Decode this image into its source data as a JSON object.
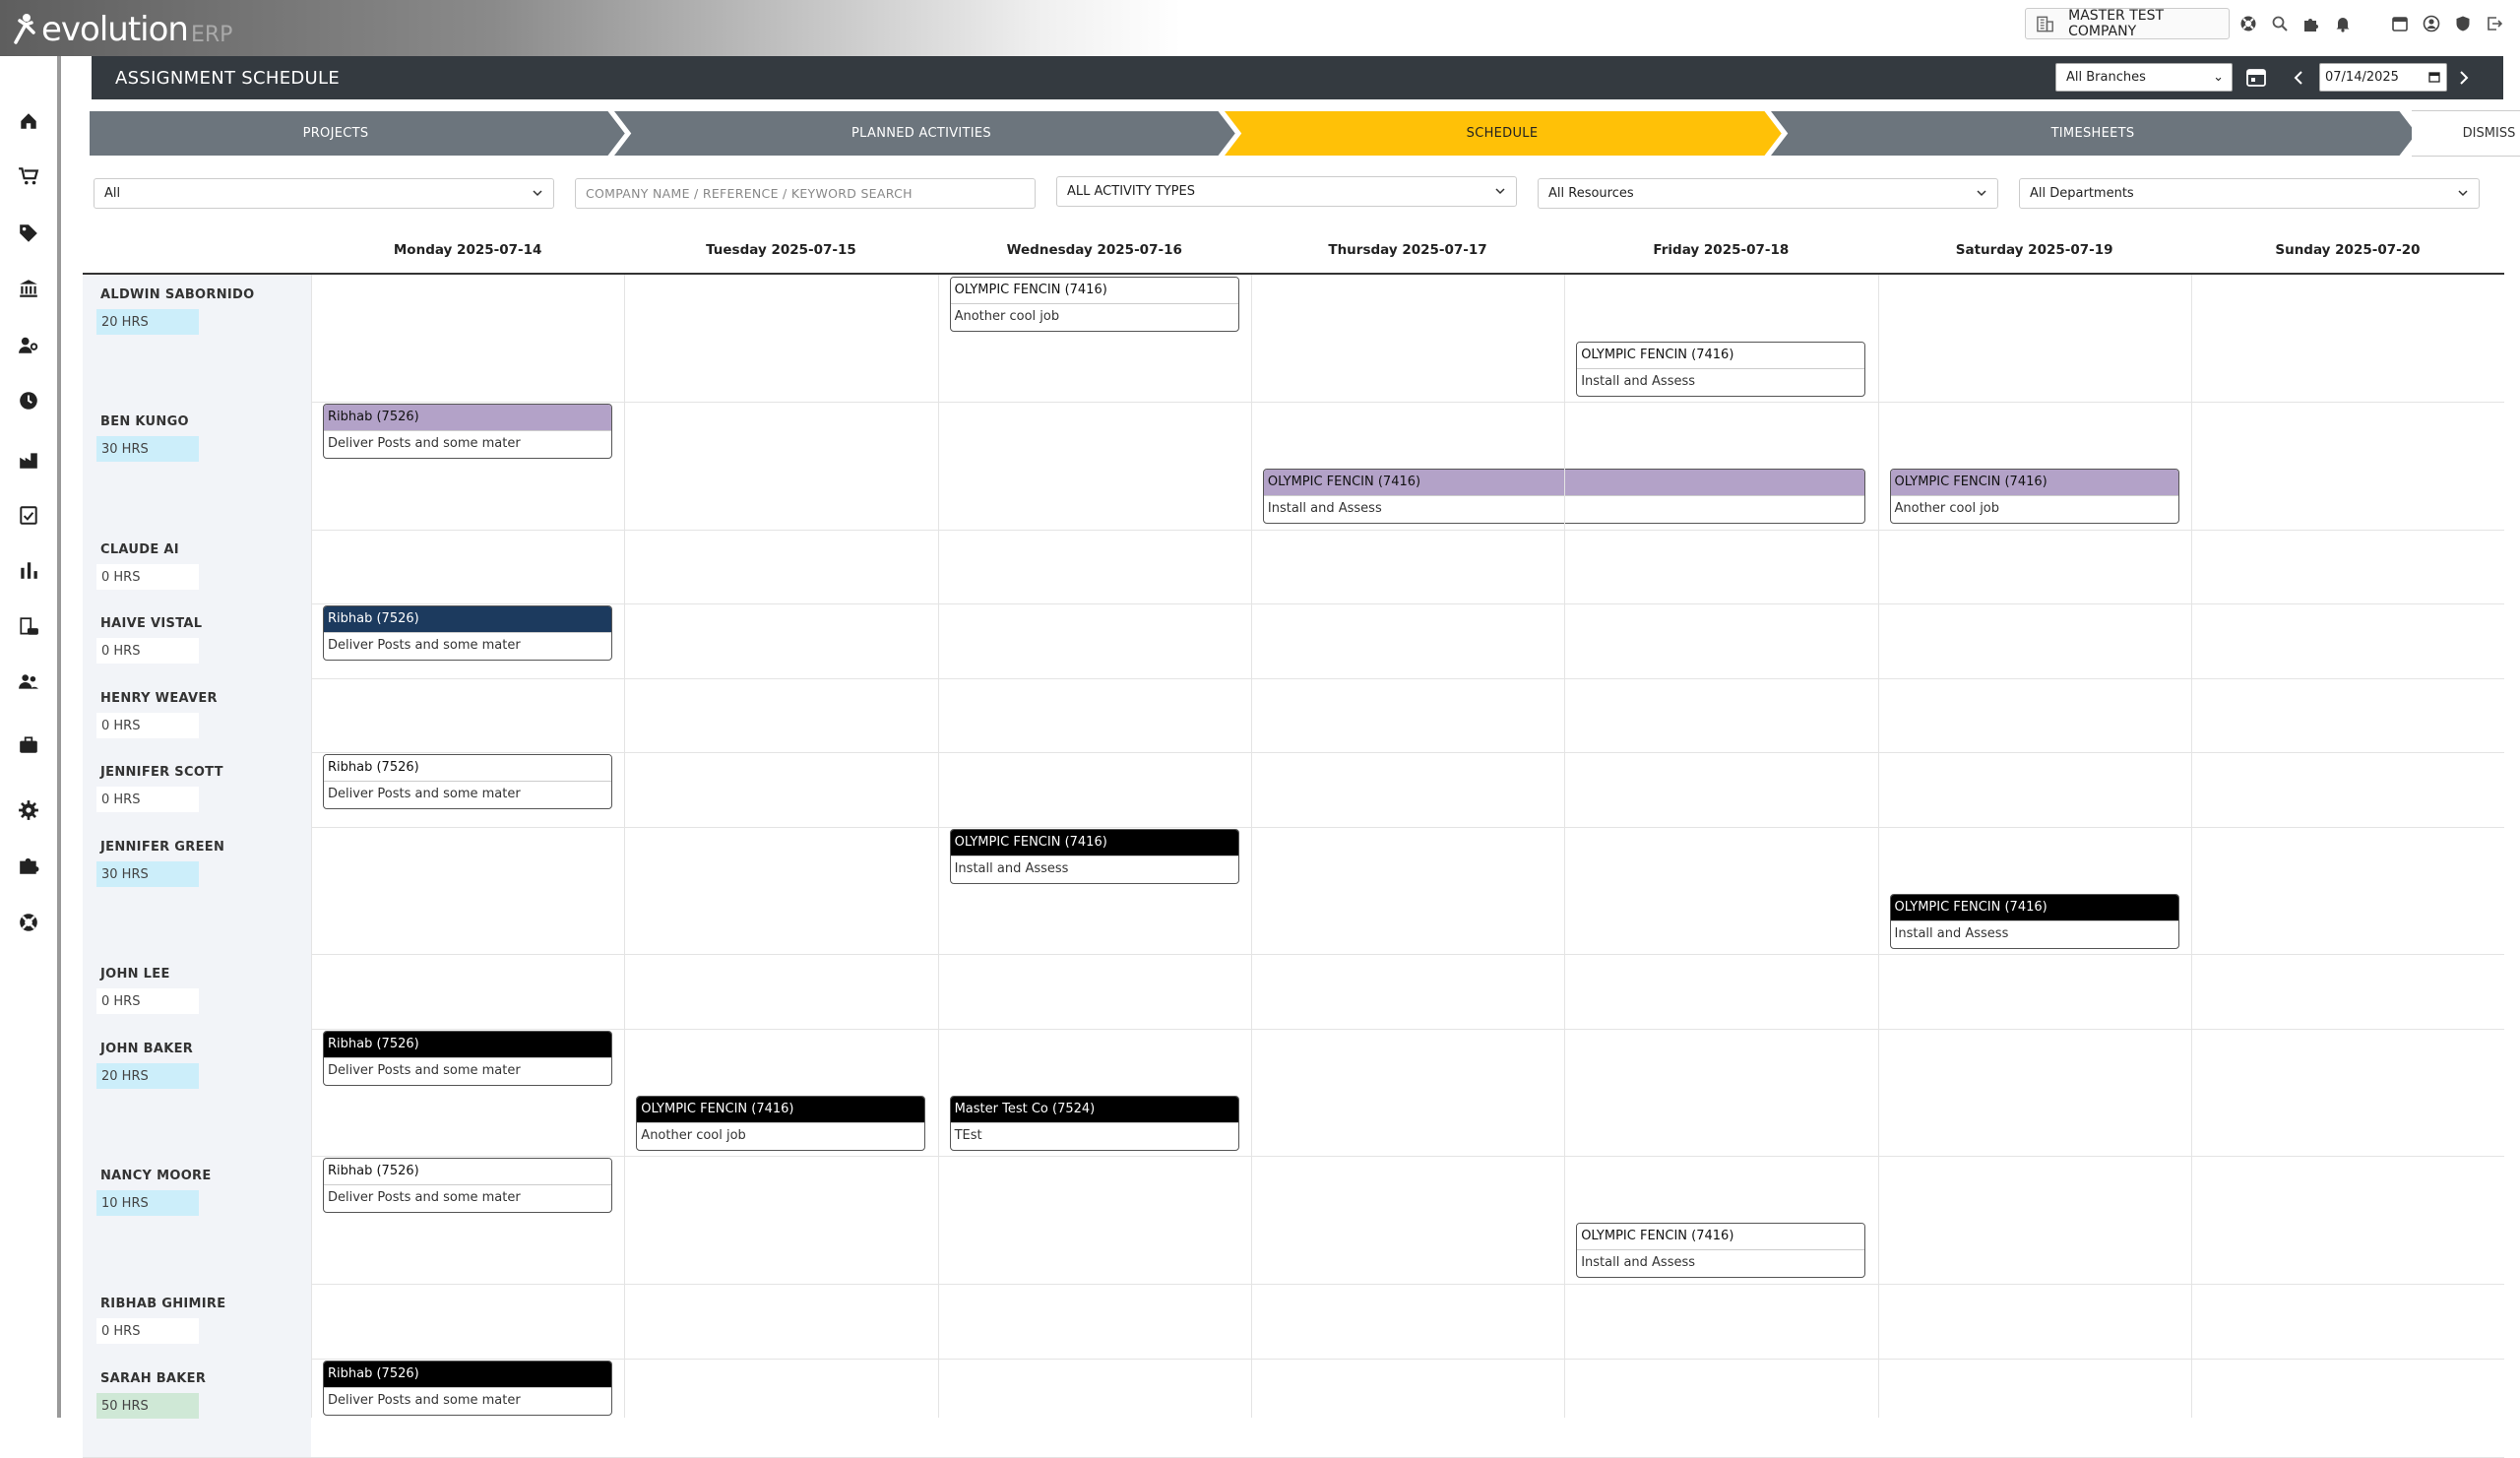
{
  "app": {
    "logo_main": "evolution",
    "logo_sub": "ERP",
    "company": "MASTER TEST COMPANY"
  },
  "topicons": [
    "lifebuoy-icon",
    "search-icon",
    "puzzle-icon",
    "bell-icon",
    "calendar-icon",
    "user-circle-icon",
    "shield-icon",
    "logout-icon"
  ],
  "sidebar": [
    "home-icon",
    "cart-icon",
    "tag-icon",
    "bank-icon",
    "user-cog-icon",
    "clock-icon",
    "factory-icon",
    "clipboard-check-icon",
    "bar-chart-icon",
    "building-car-icon",
    "users-icon",
    "briefcase-icon",
    "gear-icon",
    "puzzle-icon",
    "lifebuoy-icon"
  ],
  "header": {
    "title": "ASSIGNMENT SCHEDULE",
    "branch": "All Branches",
    "date": "07/14/2025"
  },
  "steps": [
    "PROJECTS",
    "PLANNED ACTIVITIES",
    "SCHEDULE",
    "TIMESHEETS"
  ],
  "dismiss": "DISMISS",
  "filters": {
    "status": "All",
    "search_placeholder": "COMPANY NAME / REFERENCE / KEYWORD SEARCH",
    "activity": "ALL ACTIVITY TYPES",
    "resources": "All Resources",
    "departments": "All Departments"
  },
  "days": [
    "Monday 2025-07-14",
    "Tuesday 2025-07-15",
    "Wednesday 2025-07-16",
    "Thursday 2025-07-17",
    "Friday 2025-07-18",
    "Saturday 2025-07-19",
    "Sunday 2025-07-20"
  ],
  "colors": {
    "header": "#343a40",
    "step": "#6c757d",
    "step_active": "#ffc107",
    "purple": "#b3a2c8",
    "navy": "#1c3a5e",
    "black": "#000000"
  },
  "resources": [
    {
      "name": "ALDWIN SABORNIDO",
      "hours": "20 HRS",
      "hstyle": "blue",
      "cards": [
        {
          "day": 2,
          "lane": 0,
          "span": 1,
          "style": "white",
          "title": "OLYMPIC FENCIN (7416)",
          "desc": "Another cool job"
        },
        {
          "day": 4,
          "lane": 1,
          "span": 1,
          "style": "white",
          "title": "OLYMPIC FENCIN (7416)",
          "desc": "Install and Assess"
        }
      ]
    },
    {
      "name": "BEN KUNGO",
      "hours": "30 HRS",
      "hstyle": "blue",
      "cards": [
        {
          "day": 0,
          "lane": 0,
          "span": 1,
          "style": "purple",
          "title": "Ribhab (7526)",
          "desc": "Deliver Posts and some mater"
        },
        {
          "day": 3,
          "lane": 1,
          "span": 2,
          "style": "purple",
          "title": "OLYMPIC FENCIN (7416)",
          "desc": "Install and Assess"
        },
        {
          "day": 5,
          "lane": 1,
          "span": 1,
          "style": "purple",
          "title": "OLYMPIC FENCIN (7416)",
          "desc": "Another cool job"
        }
      ]
    },
    {
      "name": "CLAUDE AI",
      "hours": "0 HRS",
      "hstyle": "white",
      "cards": []
    },
    {
      "name": "HAIVE VISTAL",
      "hours": "0 HRS",
      "hstyle": "white",
      "cards": [
        {
          "day": 0,
          "lane": 0,
          "span": 1,
          "style": "navy",
          "title": "Ribhab (7526)",
          "desc": "Deliver Posts and some mater"
        }
      ]
    },
    {
      "name": "HENRY WEAVER",
      "hours": "0 HRS",
      "hstyle": "white",
      "cards": []
    },
    {
      "name": "JENNIFER SCOTT",
      "hours": "0 HRS",
      "hstyle": "white",
      "cards": [
        {
          "day": 0,
          "lane": 0,
          "span": 1,
          "style": "white",
          "title": "Ribhab (7526)",
          "desc": "Deliver Posts and some mater"
        }
      ]
    },
    {
      "name": "JENNIFER GREEN",
      "hours": "30 HRS",
      "hstyle": "blue",
      "cards": [
        {
          "day": 2,
          "lane": 0,
          "span": 1,
          "style": "black",
          "title": "OLYMPIC FENCIN (7416)",
          "desc": "Install and Assess"
        },
        {
          "day": 5,
          "lane": 1,
          "span": 1,
          "style": "black",
          "title": "OLYMPIC FENCIN (7416)",
          "desc": "Install and Assess"
        }
      ]
    },
    {
      "name": "JOHN LEE",
      "hours": "0 HRS",
      "hstyle": "white",
      "cards": []
    },
    {
      "name": "JOHN BAKER",
      "hours": "20 HRS",
      "hstyle": "blue",
      "cards": [
        {
          "day": 0,
          "lane": 0,
          "span": 1,
          "style": "black",
          "title": "Ribhab (7526)",
          "desc": "Deliver Posts and some mater"
        },
        {
          "day": 1,
          "lane": 1,
          "span": 1,
          "style": "black",
          "title": "OLYMPIC FENCIN (7416)",
          "desc": "Another cool job"
        },
        {
          "day": 2,
          "lane": 1,
          "span": 1,
          "style": "black",
          "title": "Master Test Co (7524)",
          "desc": "TEst"
        }
      ]
    },
    {
      "name": "NANCY MOORE",
      "hours": "10 HRS",
      "hstyle": "blue",
      "cards": [
        {
          "day": 0,
          "lane": 0,
          "span": 1,
          "style": "white",
          "title": "Ribhab (7526)",
          "desc": "Deliver Posts and some mater"
        },
        {
          "day": 4,
          "lane": 1,
          "span": 1,
          "style": "white",
          "title": "OLYMPIC FENCIN (7416)",
          "desc": "Install and Assess"
        }
      ]
    },
    {
      "name": "RIBHAB GHIMIRE",
      "hours": "0 HRS",
      "hstyle": "white",
      "cards": []
    },
    {
      "name": "SARAH BAKER",
      "hours": "50 HRS",
      "hstyle": "green",
      "cards": [
        {
          "day": 0,
          "lane": 0,
          "span": 1,
          "style": "black",
          "title": "Ribhab (7526)",
          "desc": "Deliver Posts and some mater"
        }
      ]
    }
  ]
}
